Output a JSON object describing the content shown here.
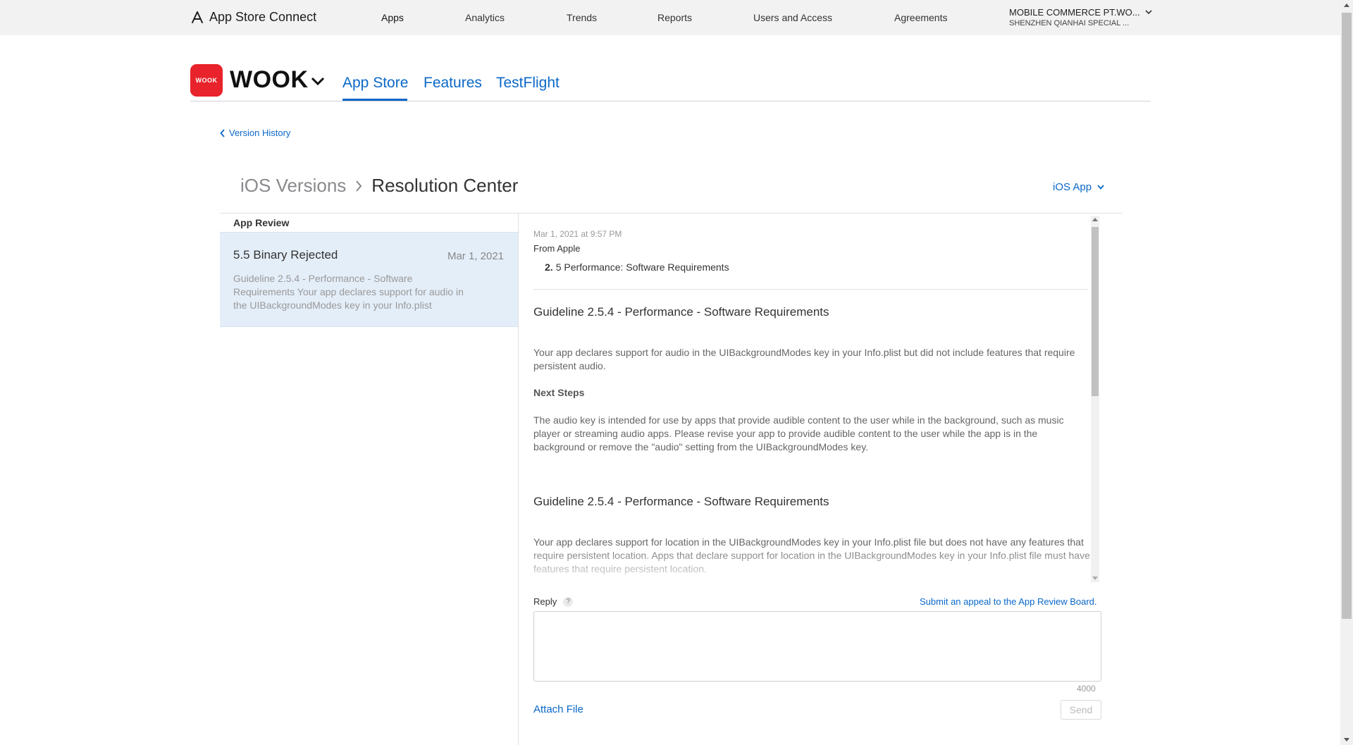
{
  "topnav": {
    "brand": "App Store Connect",
    "brand_icon": "app-store-icon",
    "links": [
      "Apps",
      "Analytics",
      "Trends",
      "Reports",
      "Users and Access",
      "Agreements"
    ],
    "active": "Apps",
    "account_name": "MOBILE COMMERCE PT.WO...",
    "account_sub": "SHENZHEN QIANHAI SPECIAL ..."
  },
  "app": {
    "icon_text": "WOOK",
    "name": "WOOK",
    "tabs": [
      "App Store",
      "Features",
      "TestFlight"
    ],
    "active_tab": "App Store"
  },
  "back_link": "Version History",
  "breadcrumb": {
    "parent": "iOS Versions",
    "current": "Resolution Center"
  },
  "platform_select": "iOS App",
  "left": {
    "section_title": "App Review",
    "items": [
      {
        "title": "5.5 Binary Rejected",
        "date": "Mar 1, 2021",
        "snippet": "Guideline 2.5.4 - Performance - Software Requirements Your app declares support for audio in the UIBackgroundModes key in your Info.plist"
      }
    ]
  },
  "message": {
    "date": "Mar 1, 2021 at 9:57 PM",
    "from": "From Apple",
    "list_num": "2.",
    "list_text": "5 Performance: Software Requirements",
    "heading1": "Guideline 2.5.4 - Performance - Software Requirements",
    "para1": "Your app declares support for audio in the UIBackgroundModes key in your Info.plist but did not include features that require persistent audio.",
    "next_steps": "Next Steps",
    "para2": "The audio key is intended for use by apps that provide audible content to the user while in the background, such as music player or streaming audio apps. Please revise your app to provide audible content to the user while the app is in the background or remove the \"audio\" setting from the UIBackgroundModes key.",
    "heading2": "Guideline 2.5.4 - Performance - Software Requirements",
    "para3": "Your app declares support for location in the UIBackgroundModes key in your Info.plist file but does not have any features that require persistent location. Apps that declare support for location in the UIBackgroundModes key in your Info.plist file must have features that require persistent location."
  },
  "reply": {
    "label": "Reply",
    "help": "?",
    "appeal_link": "Submit an appeal to the App Review Board.",
    "placeholder": "",
    "char_count": "4000",
    "attach": "Attach File",
    "send": "Send"
  },
  "colors": {
    "accent": "#0a68c8",
    "app_icon": "#e8232b",
    "selected_row": "#e4eef9"
  }
}
